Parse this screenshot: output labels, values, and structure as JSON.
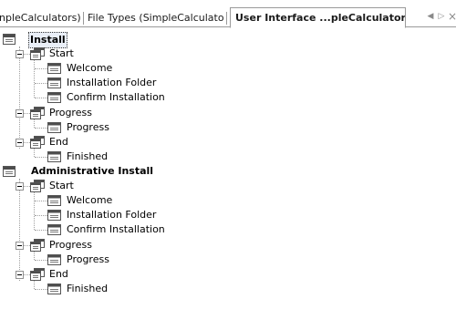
{
  "tabs": [
    {
      "label": "npleCalculators)"
    },
    {
      "label": "File Types (SimpleCalculators)"
    },
    {
      "label": "User Interface ...pleCalculators)",
      "active": true
    }
  ],
  "nav": {
    "prev": "◀",
    "next": "▷",
    "close": "×"
  },
  "tree": {
    "install": {
      "label": "Install",
      "start": {
        "label": "Start",
        "children": [
          "Welcome",
          "Installation Folder",
          "Confirm Installation"
        ]
      },
      "progress": {
        "label": "Progress",
        "children": [
          "Progress"
        ]
      },
      "end": {
        "label": "End",
        "children": [
          "Finished"
        ]
      }
    },
    "admin": {
      "label": "Administrative Install",
      "start": {
        "label": "Start",
        "children": [
          "Welcome",
          "Installation Folder",
          "Confirm Installation"
        ]
      },
      "progress": {
        "label": "Progress",
        "children": [
          "Progress"
        ]
      },
      "end": {
        "label": "End",
        "children": [
          "Finished"
        ]
      }
    }
  },
  "colors": {
    "selection_border": "#333333",
    "tree_line": "#a0a0a0",
    "tab_border": "#9a9a9a"
  }
}
